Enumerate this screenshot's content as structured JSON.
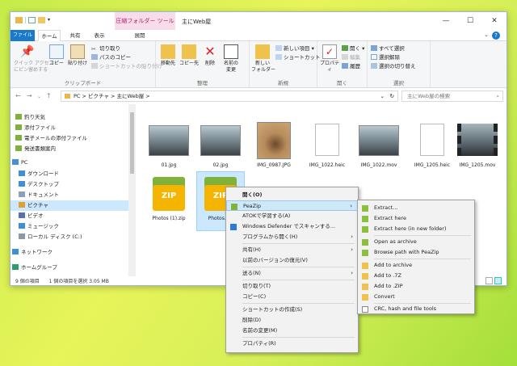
{
  "window": {
    "title": "主にWeb屋",
    "context_tab_group": "圧縮フォルダー ツール",
    "controls": {
      "minimize": "—",
      "maximize": "☐",
      "close": "✕"
    }
  },
  "ribbon": {
    "tabs": {
      "file": "ファイル",
      "home": "ホーム",
      "share": "共有",
      "view": "表示",
      "manage": "展開"
    },
    "help": "?",
    "groups": {
      "clipboard": {
        "label": "クリップボード",
        "pin": "クイック アクセス\nにピン留めする",
        "copy": "コピー",
        "paste": "貼り付け",
        "cut": "切り取り",
        "copy_path": "パスのコピー",
        "paste_shortcut": "ショートカットの貼り付け"
      },
      "organize": {
        "label": "整理",
        "move_to": "移動先",
        "copy_to": "コピー先",
        "delete": "削除",
        "rename": "名前の\n変更"
      },
      "new": {
        "label": "新規",
        "new_folder": "新しい\nフォルダー",
        "new_item": "新しい項目 ▾",
        "shortcut": "ショートカット ▾"
      },
      "open": {
        "label": "開く",
        "properties": "プロパティ",
        "open": "開く ▾",
        "edit": "編集",
        "history": "履歴"
      },
      "select": {
        "label": "選択",
        "select_all": "すべて選択",
        "select_none": "選択解除",
        "invert": "選択の切り替え"
      }
    }
  },
  "address": {
    "path": "PC  >  ピクチャ  >  主にWeb屋  >",
    "search_placeholder": "主にWeb屋の検索"
  },
  "nav": {
    "items": [
      {
        "label": "釣り天気",
        "icon": "pin-folder-icon"
      },
      {
        "label": "添付ファイル",
        "icon": "pin-folder-icon"
      },
      {
        "label": "電子メールの添付ファイル",
        "icon": "pin-folder-icon"
      },
      {
        "label": "発送書類案内",
        "icon": "pin-folder-icon"
      },
      {
        "label": "PC",
        "icon": "pc-icon"
      },
      {
        "label": "ダウンロード",
        "icon": "download-folder-icon"
      },
      {
        "label": "デスクトップ",
        "icon": "desktop-folder-icon"
      },
      {
        "label": "ドキュメント",
        "icon": "documents-folder-icon"
      },
      {
        "label": "ピクチャ",
        "icon": "pictures-folder-icon"
      },
      {
        "label": "ビデオ",
        "icon": "videos-folder-icon"
      },
      {
        "label": "ミュージック",
        "icon": "music-folder-icon"
      },
      {
        "label": "ローカル ディスク (C:)",
        "icon": "disk-icon"
      },
      {
        "label": "ネットワーク",
        "icon": "network-icon"
      },
      {
        "label": "ホームグループ",
        "icon": "homegroup-icon"
      }
    ]
  },
  "files": [
    {
      "name": "01.jpg",
      "kind": "photo-laptop"
    },
    {
      "name": "02.jpg",
      "kind": "photo-laptop"
    },
    {
      "name": "IMG_0987.JPG",
      "kind": "photo-brush"
    },
    {
      "name": "IMG_1022.heic",
      "kind": "blank"
    },
    {
      "name": "IMG_1022.mov",
      "kind": "photo-laptop"
    },
    {
      "name": "IMG_1205.heic",
      "kind": "blank"
    },
    {
      "name": "IMG_1205.mov",
      "kind": "video"
    },
    {
      "name": "Photos (1).zip",
      "kind": "zip"
    },
    {
      "name": "Photos.zip",
      "kind": "zip"
    }
  ],
  "status": {
    "count": "9 個の項目",
    "selection": "1 個の項目を選択  3.05 MB"
  },
  "context_menu": {
    "open": "開く(O)",
    "peazip": "PeaZip",
    "atok": "ATOKで学習する(A)",
    "defender": "Windows Defender でスキャンする...",
    "open_with": "プログラムから開く(H)",
    "share": "共有(H)",
    "restore": "以前のバージョンの復元(V)",
    "send_to": "送る(N)",
    "cut": "切り取り(T)",
    "copy": "コピー(C)",
    "create_shortcut": "ショートカットの作成(S)",
    "delete": "削除(D)",
    "rename": "名前の変更(M)",
    "properties": "プロパティ(R)",
    "arrow": "›"
  },
  "submenu": {
    "extract": "Extract...",
    "extract_here": "Extract here",
    "extract_here_folder": "Extract here (in new folder)",
    "open_archive": "Open as archive",
    "browse": "Browse path with PeaZip",
    "add_archive": "Add to archive",
    "add_7z": "Add to .7Z",
    "add_zip": "Add to .ZIP",
    "convert": "Convert",
    "crc": "CRC, hash and file tools"
  },
  "colors": {
    "accent": "#1979ca",
    "selection": "#cce8ff",
    "zip_yellow": "#f5b400"
  }
}
